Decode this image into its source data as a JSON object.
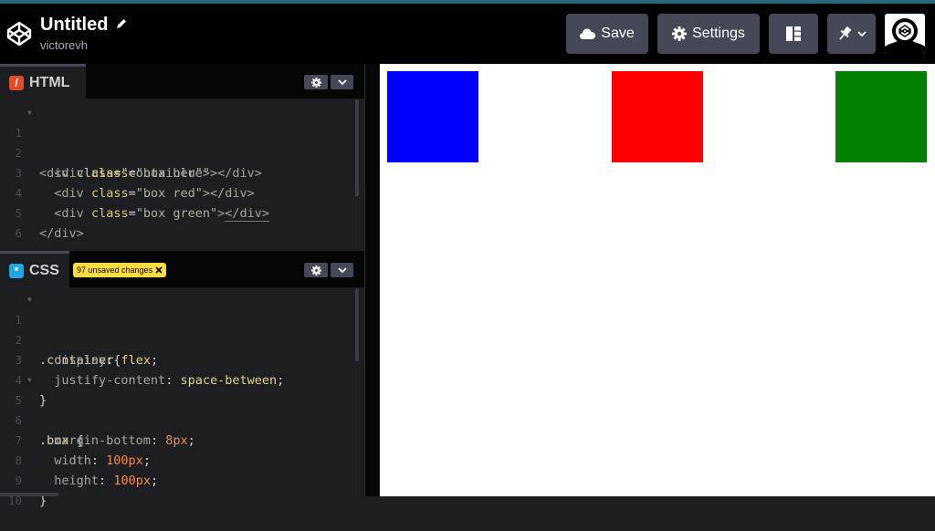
{
  "header": {
    "title": "Untitled",
    "username": "victorevh",
    "save_label": "Save",
    "settings_label": "Settings"
  },
  "html_panel": {
    "label": "HTML",
    "line_numbers": [
      "1",
      "2",
      "3",
      "4",
      "5",
      "6"
    ],
    "lines": [
      {
        "indent": "",
        "open": "<",
        "tag": "div",
        "sp": " ",
        "attr": "class",
        "eq": "=",
        "str": "\"container\"",
        "close": ">",
        "end": ""
      },
      {
        "indent": "  ",
        "open": "<",
        "tag": "div",
        "sp": " ",
        "attr": "class",
        "eq": "=",
        "str": "\"box blue\"",
        "close": ">",
        "end": "</div>"
      },
      {
        "indent": "  ",
        "open": "<",
        "tag": "div",
        "sp": " ",
        "attr": "class",
        "eq": "=",
        "str": "\"box red\"",
        "close": ">",
        "end": "</div>"
      },
      {
        "indent": "  ",
        "open": "<",
        "tag": "div",
        "sp": " ",
        "attr": "class",
        "eq": "=",
        "str": "\"box green\"",
        "close": ">",
        "end": "</div>"
      }
    ],
    "line5": "</div>"
  },
  "css_panel": {
    "label": "CSS",
    "unsaved_badge": "97 unsaved changes",
    "line_numbers": [
      "1",
      "2",
      "3",
      "4",
      "5",
      "6",
      "7",
      "8",
      "9",
      "10"
    ],
    "line1_sel": ".container",
    "line1_brace": "{",
    "line2_prop": "display",
    "line2_val": "flex",
    "line3_prop": "justify-content",
    "line3_val": "space-between",
    "line4": "}",
    "line5_sel": ".box",
    "line5_brace": " {",
    "line6_prop": "margin-bottom",
    "line6_val": "8px",
    "line7_prop": "width",
    "line7_val": "100px",
    "line8_prop": "height",
    "line8_val": "100px",
    "line9": "}"
  },
  "preview": {
    "box_colors": [
      "#0000ff",
      "#ff0000",
      "#008000"
    ]
  },
  "colors": {
    "accent_yellow": "#ffdd40",
    "html_badge": "#e34c26",
    "css_badge": "#1ea7e1",
    "button_bg": "#444857"
  }
}
